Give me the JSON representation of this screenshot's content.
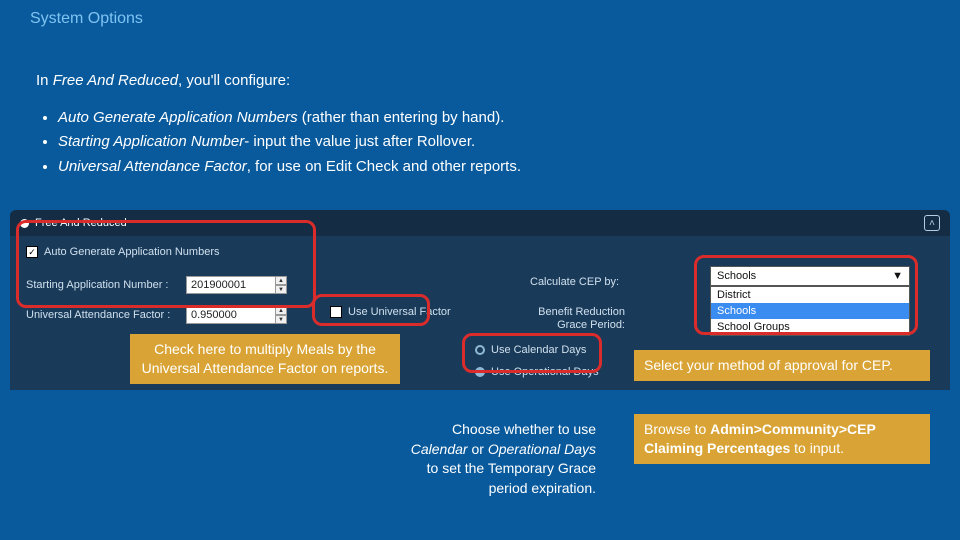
{
  "page_title": "System Options",
  "intro": {
    "lead_prefix": "In ",
    "lead_emph": "Free And Reduced",
    "lead_suffix": ", you'll configure:",
    "bullets": [
      {
        "emph": "Auto Generate Application Numbers",
        "rest": " (rather than entering by hand)."
      },
      {
        "emph": "Starting Application Number",
        "rest": "- input the value just after Rollover."
      },
      {
        "emph": "Universal Attendance Factor",
        "rest": ", for use on Edit Check and other reports."
      }
    ]
  },
  "panel": {
    "title": "Free And Reduced",
    "auto_gen_label": "Auto Generate Application Numbers",
    "auto_gen_checked": true,
    "starting_label": "Starting Application Number :",
    "starting_value": "201900001",
    "uaf_label": "Universal Attendance Factor :",
    "uaf_value": "0.950000",
    "use_universal_label": "Use Universal Factor",
    "use_universal_checked": false,
    "calculate_cep_label": "Calculate CEP by:",
    "cep_selected": "Schools",
    "cep_options": [
      "District",
      "Schools",
      "School Groups"
    ],
    "benefit_label_line1": "Benefit Reduction",
    "benefit_label_line2": "Grace Period:",
    "radio_calendar": "Use Calendar Days",
    "radio_operational": "Use Operational Days",
    "radio_selected": "operational"
  },
  "callouts": {
    "check_universal": "Check here to multiply Meals by the Universal Attendance Factor on reports.",
    "days_note_l1": "Choose whether to use",
    "days_note_l2_em1": "Calendar",
    "days_note_l2_mid": " or ",
    "days_note_l2_em2": "Operational Days",
    "days_note_l3": "to set the Temporary Grace",
    "days_note_l4": "period expiration.",
    "cep_select": "Select your method of approval for CEP.",
    "cep_browse_prefix": "Browse to ",
    "cep_browse_bold": "Admin>Community>CEP Claiming Percentages",
    "cep_browse_suffix": " to input."
  }
}
